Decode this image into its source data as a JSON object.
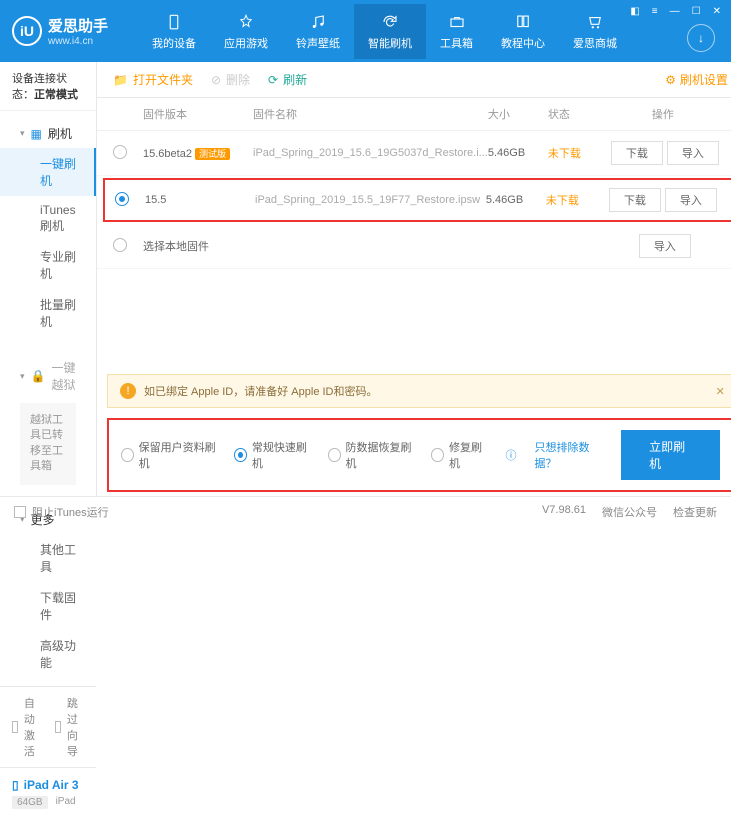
{
  "header": {
    "title": "爱思助手",
    "url": "www.i4.cn",
    "nav": [
      "我的设备",
      "应用游戏",
      "铃声壁纸",
      "智能刷机",
      "工具箱",
      "教程中心",
      "爱思商城"
    ]
  },
  "sidebar": {
    "conn_label": "设备连接状态：",
    "conn_value": "正常模式",
    "flash_header": "刷机",
    "flash_items": [
      "一键刷机",
      "iTunes刷机",
      "专业刷机",
      "批量刷机"
    ],
    "jail_header": "一键越狱",
    "jail_moved": "越狱工具已转移至工具箱",
    "more_header": "更多",
    "more_items": [
      "其他工具",
      "下载固件",
      "高级功能"
    ],
    "auto_activate": "自动激活",
    "skip_guide": "跳过向导",
    "device": {
      "name": "iPad Air 3",
      "storage": "64GB",
      "type": "iPad"
    }
  },
  "toolbar": {
    "open": "打开文件夹",
    "delete": "删除",
    "refresh": "刷新",
    "settings": "刷机设置"
  },
  "table": {
    "cols": {
      "ver": "固件版本",
      "name": "固件名称",
      "size": "大小",
      "status": "状态",
      "ops": "操作"
    },
    "rows": [
      {
        "ver": "15.6beta2",
        "beta": "测试版",
        "name": "iPad_Spring_2019_15.6_19G5037d_Restore.i...",
        "size": "5.46GB",
        "status": "未下载"
      },
      {
        "ver": "15.5",
        "beta": "",
        "name": "iPad_Spring_2019_15.5_19F77_Restore.ipsw",
        "size": "5.46GB",
        "status": "未下载"
      }
    ],
    "local": "选择本地固件",
    "download": "下载",
    "import": "导入"
  },
  "notice": "如已绑定 Apple ID，请准备好 Apple ID和密码。",
  "flash": {
    "opts": [
      "保留用户资料刷机",
      "常规快速刷机",
      "防数据恢复刷机",
      "修复刷机"
    ],
    "exclude": "只想排除数据？",
    "go": "立即刷机"
  },
  "footer": {
    "block": "阻止iTunes运行",
    "version": "V7.98.61",
    "wechat": "微信公众号",
    "update": "检查更新"
  }
}
